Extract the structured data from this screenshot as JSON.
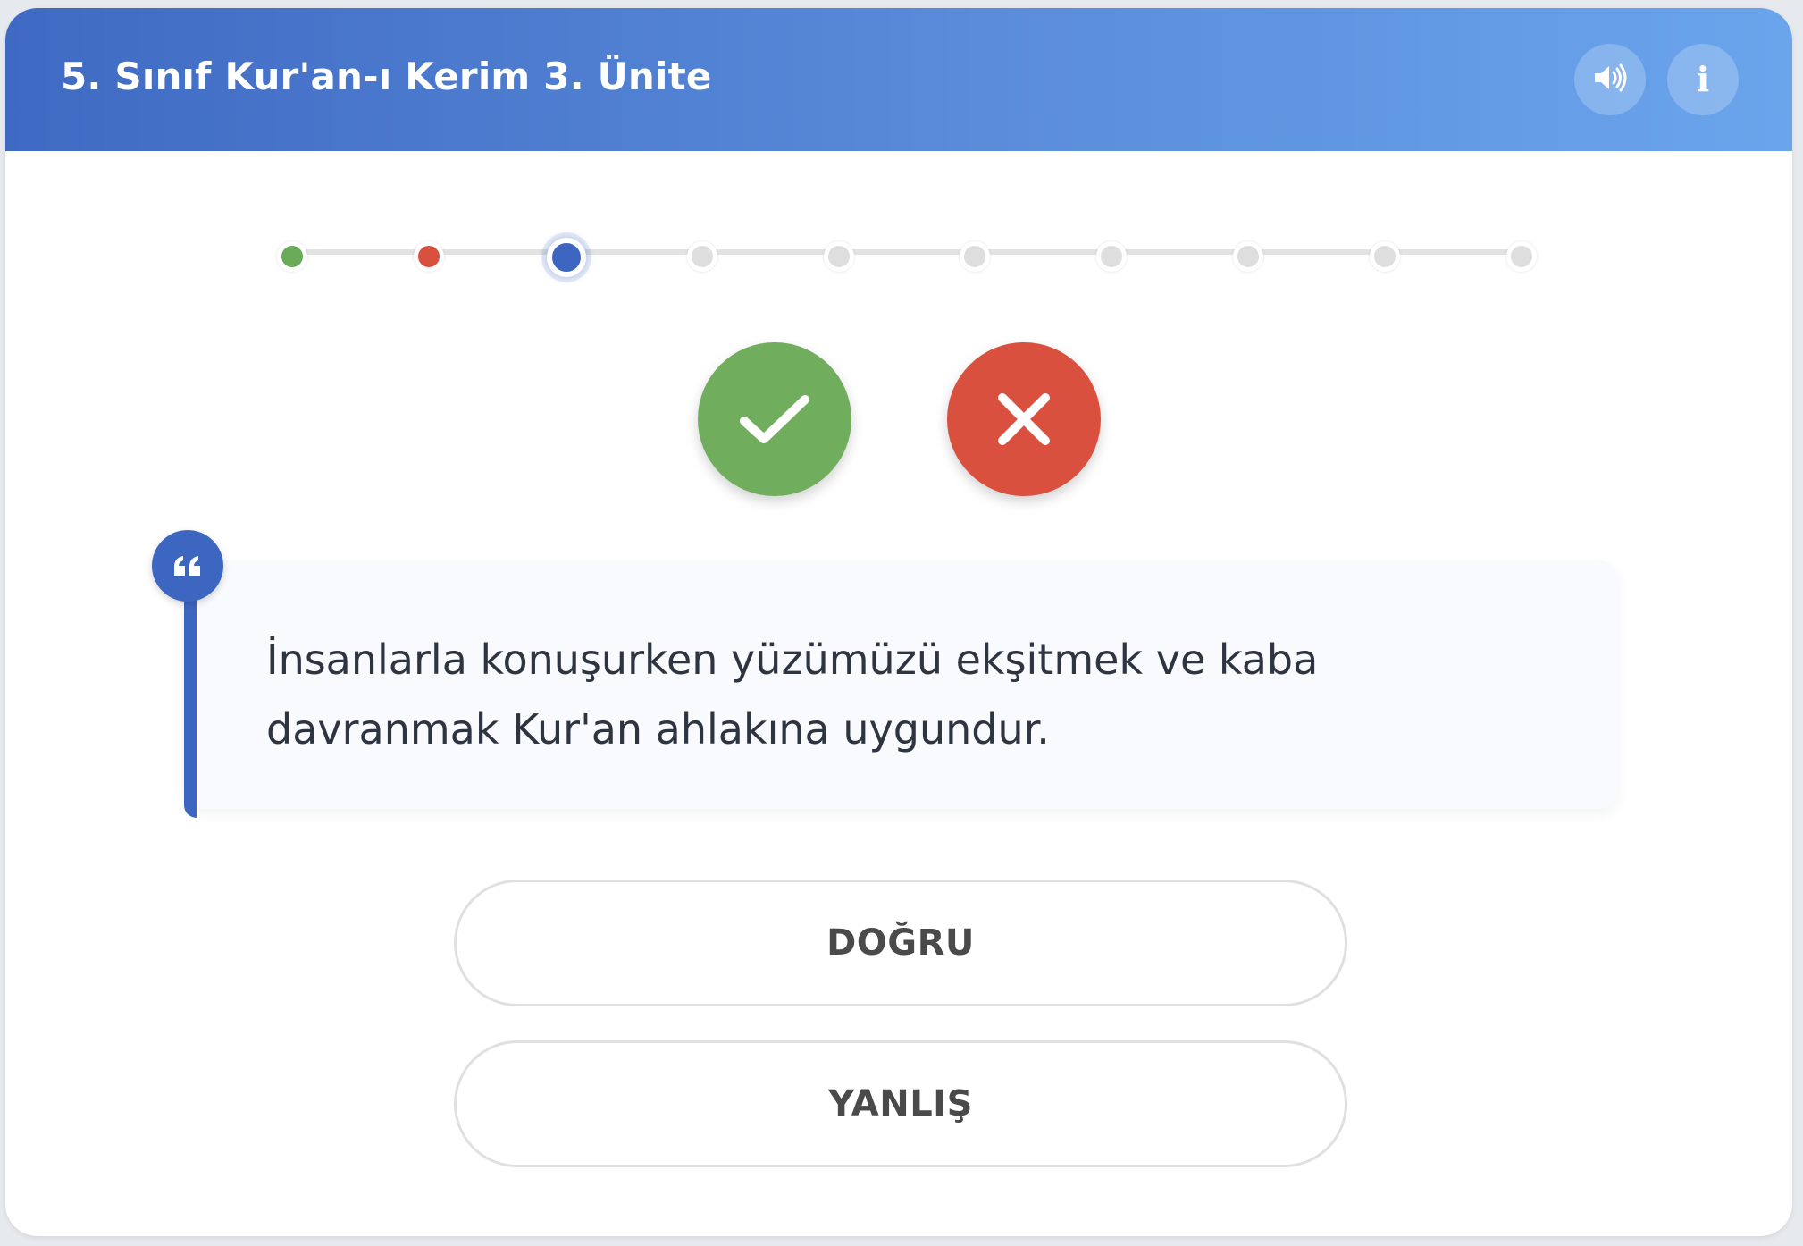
{
  "header": {
    "title": "5. Sınıf Kur'an-ı Kerim 3. Ünite",
    "sound_icon": "speaker-icon",
    "info_icon": "info-icon",
    "info_glyph": "i"
  },
  "progress": {
    "total": 10,
    "current_index": 3,
    "steps": [
      "correct",
      "wrong",
      "current",
      "pending",
      "pending",
      "pending",
      "pending",
      "pending",
      "pending",
      "pending"
    ],
    "colors": {
      "correct": "#6aab5a",
      "wrong": "#d9503f",
      "current": "#3d66c1",
      "pending": "#dedede"
    }
  },
  "feedback": {
    "correct_icon": "checkmark-icon",
    "wrong_icon": "cross-icon",
    "correct_color": "#70ad5c",
    "wrong_color": "#d9503f"
  },
  "question": {
    "icon": "quote-icon",
    "text": "İnsanlarla konuşurken yüzümüzü ekşitmek ve kaba davranmak Kur'an ahlakına uygundur."
  },
  "answers": [
    {
      "label": "DOĞRU"
    },
    {
      "label": "YANLIŞ"
    }
  ],
  "accent_color": "#3d66c1"
}
